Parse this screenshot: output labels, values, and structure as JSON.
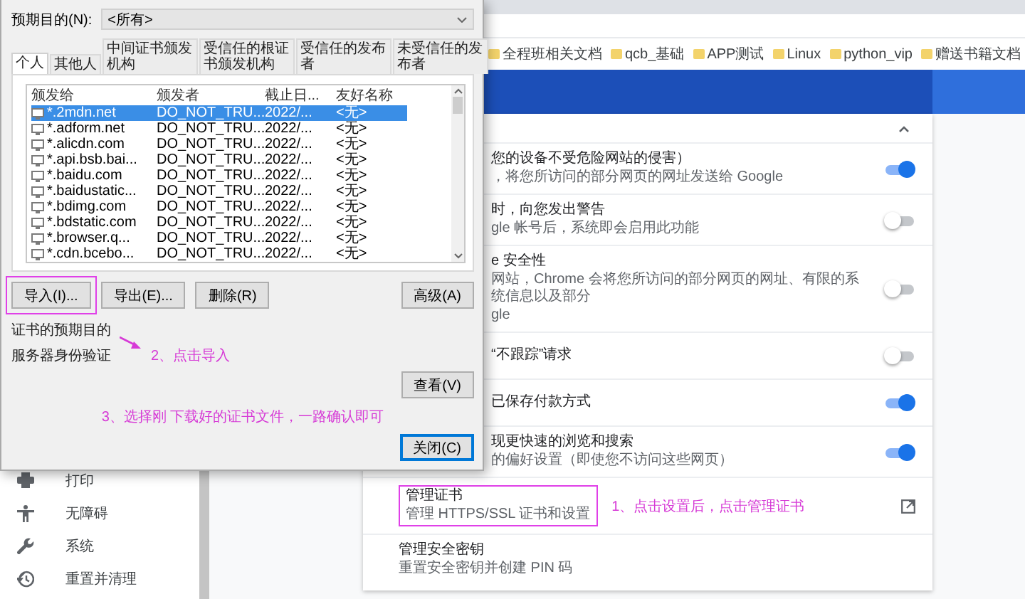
{
  "browser": {
    "bookmarks": [
      "全程班相关文档",
      "qcb_基础",
      "APP测试",
      "Linux",
      "python_vip",
      "赠送书籍文档"
    ]
  },
  "sidebar": {
    "items": [
      {
        "label": "打印"
      },
      {
        "label": "无障碍"
      },
      {
        "label": "系统"
      },
      {
        "label": "重置并清理"
      }
    ]
  },
  "settings": {
    "rows": [
      {
        "kind": "toggle",
        "title": "您的设备不受危险网站的侵害）",
        "subtitle": [
          "，将您所访问的部分网页的网址发送给 Google"
        ],
        "on": true
      },
      {
        "kind": "toggle",
        "title": "时，向您发出警告",
        "subtitle": [
          "gle 帐号后，系统即会启用此功能"
        ],
        "on": false
      },
      {
        "kind": "toggle",
        "title": "e 安全性",
        "subtitle": [
          "网站，Chrome 会将您所访问的部分网页的网址、有限的系统信息以及部分",
          "gle"
        ],
        "on": false
      },
      {
        "kind": "toggle",
        "title": "“不跟踪”请求",
        "subtitle": [],
        "on": false
      },
      {
        "kind": "toggle",
        "title": "已保存付款方式",
        "subtitle": [],
        "on": true
      },
      {
        "kind": "toggle",
        "title": "现更快速的浏览和搜索",
        "subtitle": [
          "的偏好设置（即使您不访问这些网页）"
        ],
        "on": true
      },
      {
        "kind": "link",
        "title": "管理证书",
        "subtitle": [
          "管理 HTTPS/SSL 证书和设置"
        ],
        "highlighted": true,
        "note": "1、点击设置后，点击管理证书"
      },
      {
        "kind": "plain",
        "title": "管理安全密钥",
        "subtitle": [
          "重置安全密钥并创建 PIN 码"
        ]
      }
    ]
  },
  "dialog": {
    "purpose_label": "预期目的(N):",
    "purpose_value": "<所有>",
    "tabs": [
      {
        "label": "个人",
        "selected": true
      },
      {
        "label": "其他人",
        "selected": false
      },
      {
        "label": "中间证书颁发机构",
        "selected": false
      },
      {
        "label": "受信任的根证书颁发机构",
        "selected": false
      },
      {
        "label": "受信任的发布者",
        "selected": false
      },
      {
        "label": "未受信任的发布者",
        "selected": false
      }
    ],
    "columns": [
      "颁发给",
      "颁发者",
      "截止日...",
      "友好名称"
    ],
    "rows": [
      {
        "cells": [
          "*.2mdn.net",
          "DO_NOT_TRU...",
          "2022/...",
          "<无>"
        ],
        "selected": true
      },
      {
        "cells": [
          "*.adform.net",
          "DO_NOT_TRU...",
          "2022/...",
          "<无>"
        ],
        "selected": false
      },
      {
        "cells": [
          "*.alicdn.com",
          "DO_NOT_TRU...",
          "2022/...",
          "<无>"
        ],
        "selected": false
      },
      {
        "cells": [
          "*.api.bsb.bai...",
          "DO_NOT_TRU...",
          "2022/...",
          "<无>"
        ],
        "selected": false
      },
      {
        "cells": [
          "*.baidu.com",
          "DO_NOT_TRU...",
          "2022/...",
          "<无>"
        ],
        "selected": false
      },
      {
        "cells": [
          "*.baidustatic...",
          "DO_NOT_TRU...",
          "2022/...",
          "<无>"
        ],
        "selected": false
      },
      {
        "cells": [
          "*.bdimg.com",
          "DO_NOT_TRU...",
          "2022/...",
          "<无>"
        ],
        "selected": false
      },
      {
        "cells": [
          "*.bdstatic.com",
          "DO_NOT_TRU...",
          "2022/...",
          "<无>"
        ],
        "selected": false
      },
      {
        "cells": [
          "*.browser.q...",
          "DO_NOT_TRU...",
          "2022/...",
          "<无>"
        ],
        "selected": false
      },
      {
        "cells": [
          "*.cdn.bcebo...",
          "DO_NOT_TRU...",
          "2022/...",
          "<无>"
        ],
        "selected": false
      }
    ],
    "actions": [
      {
        "label": "导入(I)...",
        "highlighted": true
      },
      {
        "label": "导出(E)...",
        "highlighted": false
      },
      {
        "label": "删除(R)",
        "highlighted": false
      }
    ],
    "advanced_button": "高级(A)",
    "purpose_title": "证书的预期目的",
    "purpose_text": "服务器身份验证",
    "import_note": "2、点击导入",
    "view_button": "查看(V)",
    "file_note": "3、选择刚 下载好的证书文件，一路确认即可",
    "close_button": "关闭(C)"
  }
}
